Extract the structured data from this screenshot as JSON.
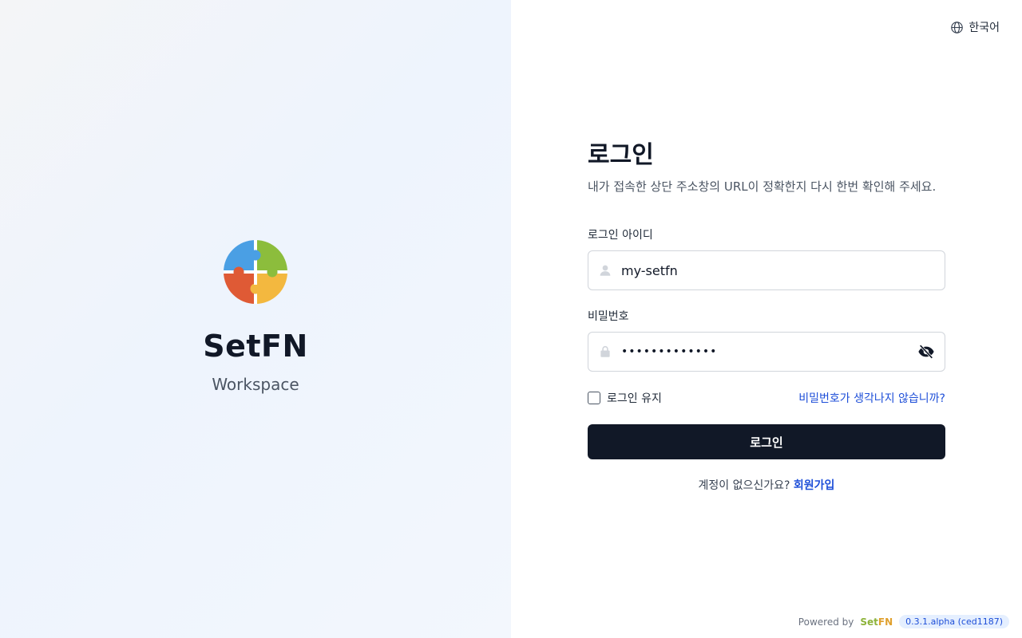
{
  "brand": {
    "name": "SetFN",
    "subtitle": "Workspace",
    "logo_colors": [
      "#4a9fe4",
      "#8cbd3c",
      "#df5a35",
      "#f3b83f"
    ]
  },
  "language": {
    "icon": "globe-icon",
    "label": "한국어"
  },
  "login": {
    "title": "로그인",
    "description": "내가 접속한 상단 주소창의 URL이 정확한지 다시 한번 확인해 주세요.",
    "id_label": "로그인 아이디",
    "id_value": "my-setfn",
    "id_icon": "user-icon",
    "password_label": "비밀번호",
    "password_value": "setfnpassword",
    "password_icon": "lock-icon",
    "password_toggle_icon": "eye-off-icon",
    "remember_label": "로그인 유지",
    "remember_checked": false,
    "forgot_link": "비밀번호가 생각나지 않습니까?",
    "submit_label": "로그인",
    "signup_prompt": "계정이 없으신가요?",
    "signup_link": "회원가입"
  },
  "footer": {
    "powered_by": "Powered by",
    "brand_set": "Set",
    "brand_fn": "FN",
    "version": "0.3.1.alpha (ced1187)"
  },
  "colors": {
    "primary_button": "#111827",
    "link": "#1d4ed8",
    "badge_bg": "#e5efff"
  }
}
